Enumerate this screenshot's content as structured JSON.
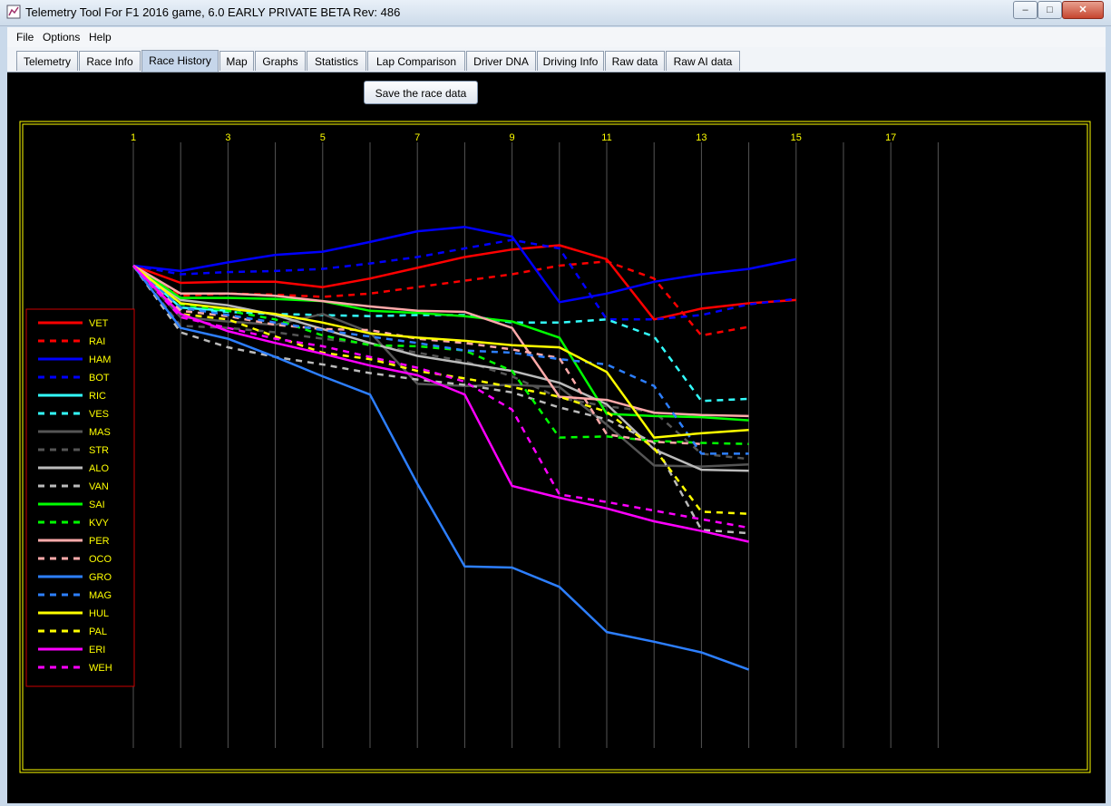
{
  "window": {
    "title": "Telemetry Tool For F1 2016 game, 6.0 EARLY PRIVATE BETA Rev: 486",
    "minimize_glyph": "–",
    "maximize_glyph": "□",
    "close_glyph": "✕"
  },
  "menu": {
    "items": [
      "File",
      "Options",
      "Help"
    ]
  },
  "tabs": [
    "Telemetry",
    "Race Info",
    "Race History",
    "Map",
    "Graphs",
    "Statistics",
    "Lap Comparison",
    "Driver DNA",
    "Driving Info",
    "Raw data",
    "Raw AI data"
  ],
  "active_tab": "Race History",
  "toolbar": {
    "save_label": "Save the race data"
  },
  "colors": {
    "background": "#000000",
    "frame": "#ffff00",
    "tick_text": "#ffff00",
    "grid": "#555555",
    "legend_border": "#cc0000",
    "legend_text": "#ffff00"
  },
  "chart_data": {
    "type": "line",
    "x_ticks": [
      "1",
      "3",
      "5",
      "7",
      "9",
      "11",
      "13",
      "15",
      "17"
    ],
    "x_range": [
      1,
      18
    ],
    "y_range": [
      -8,
      30
    ],
    "series": [
      {
        "name": "VET",
        "color": "#ff0000",
        "dash": false,
        "x": [
          1,
          2,
          3,
          4,
          5,
          6,
          7,
          8,
          9,
          10,
          11,
          12,
          13,
          14,
          15
        ],
        "values": [
          0,
          1.6,
          1.5,
          1.5,
          2.0,
          1.2,
          0.2,
          -0.8,
          -1.5,
          -1.9,
          -0.6,
          5.0,
          4.0,
          3.5,
          3.2
        ]
      },
      {
        "name": "RAI",
        "color": "#ff0000",
        "dash": true,
        "x": [
          1,
          2,
          3,
          4,
          5,
          6,
          7,
          8,
          9,
          10,
          11,
          12,
          13,
          14
        ],
        "values": [
          0,
          2.8,
          2.6,
          2.7,
          2.9,
          2.6,
          2.0,
          1.4,
          0.8,
          0.0,
          -0.4,
          1.2,
          6.5,
          5.7
        ]
      },
      {
        "name": "HAM",
        "color": "#0000ff",
        "dash": false,
        "x": [
          1,
          2,
          3,
          4,
          5,
          6,
          7,
          8,
          9,
          10,
          11,
          12,
          13,
          14,
          15
        ],
        "values": [
          0,
          0.5,
          -0.3,
          -1.0,
          -1.3,
          -2.2,
          -3.2,
          -3.6,
          -2.7,
          3.4,
          2.6,
          1.5,
          0.8,
          0.3,
          -0.6
        ]
      },
      {
        "name": "BOT",
        "color": "#0000ff",
        "dash": true,
        "x": [
          1,
          2,
          3,
          4,
          5,
          6,
          7,
          8,
          9,
          10,
          11,
          12,
          13,
          14,
          15
        ],
        "values": [
          0,
          0.8,
          0.6,
          0.5,
          0.3,
          -0.2,
          -0.8,
          -1.6,
          -2.4,
          -1.6,
          5.0,
          5.0,
          4.6,
          3.6,
          3.1
        ]
      },
      {
        "name": "RIC",
        "color": "#33ffff",
        "dash": false,
        "x": [
          1,
          2,
          3
        ],
        "values": [
          0,
          3.9,
          4.2
        ]
      },
      {
        "name": "VES",
        "color": "#33ffff",
        "dash": true,
        "x": [
          1,
          2,
          3,
          4,
          5,
          6,
          7,
          8,
          9,
          10,
          11,
          12,
          13,
          14
        ],
        "values": [
          0,
          4.0,
          4.3,
          4.5,
          4.6,
          4.7,
          4.6,
          4.6,
          5.3,
          5.3,
          5.0,
          6.6,
          12.6,
          12.4
        ]
      },
      {
        "name": "MAS",
        "color": "#555555",
        "dash": false,
        "x": [
          1,
          2,
          3,
          4,
          5,
          6,
          7,
          8,
          9,
          10,
          11,
          12,
          13,
          14
        ],
        "values": [
          0,
          4.8,
          5.2,
          5.5,
          4.5,
          6.2,
          11.0,
          11.2,
          11.1,
          11.3,
          14.8,
          18.6,
          18.7,
          18.5
        ]
      },
      {
        "name": "STR",
        "color": "#555555",
        "dash": true,
        "x": [
          1,
          2,
          3,
          4,
          5,
          6,
          7,
          8,
          9,
          10,
          11,
          12,
          13,
          14
        ],
        "values": [
          0,
          5.6,
          5.8,
          6.2,
          6.8,
          7.3,
          8.1,
          8.9,
          10.3,
          12.3,
          13.1,
          13.6,
          17.5,
          18.0
        ]
      },
      {
        "name": "ALO",
        "color": "#bbbbbb",
        "dash": false,
        "x": [
          1,
          2,
          3,
          4,
          5,
          6,
          7,
          8,
          9,
          10,
          11,
          12,
          13,
          14
        ],
        "values": [
          0,
          3.2,
          3.7,
          4.6,
          5.9,
          7.2,
          8.4,
          9.1,
          9.8,
          10.9,
          12.9,
          17.1,
          19.0,
          19.1
        ]
      },
      {
        "name": "VAN",
        "color": "#bbbbbb",
        "dash": true,
        "x": [
          1,
          2,
          3,
          4,
          5,
          6,
          7,
          8,
          9,
          10,
          11,
          12,
          13,
          14
        ],
        "values": [
          0,
          6.2,
          7.6,
          8.5,
          9.2,
          10.0,
          10.6,
          11.1,
          11.8,
          13.2,
          14.3,
          16.5,
          24.6,
          24.9
        ]
      },
      {
        "name": "SAI",
        "color": "#00ff00",
        "dash": false,
        "x": [
          1,
          2,
          3,
          4,
          5,
          6,
          7,
          8,
          9,
          10,
          11,
          12,
          13,
          14
        ],
        "values": [
          0,
          3.0,
          3.0,
          3.1,
          3.3,
          4.2,
          4.4,
          4.7,
          5.2,
          6.7,
          13.8,
          14.0,
          14.1,
          14.4
        ]
      },
      {
        "name": "KVY",
        "color": "#00ff00",
        "dash": true,
        "x": [
          1,
          2,
          3,
          4,
          5,
          6,
          7,
          8,
          9,
          10,
          11,
          12,
          13,
          14
        ],
        "values": [
          0,
          3.6,
          4.2,
          5.0,
          6.5,
          7.4,
          7.5,
          7.9,
          9.8,
          16.0,
          15.9,
          16.3,
          16.5,
          16.6
        ]
      },
      {
        "name": "PER",
        "color": "#ffaaaa",
        "dash": false,
        "x": [
          1,
          2,
          3,
          4,
          5,
          6,
          7,
          8,
          9,
          10,
          11,
          12,
          13,
          14
        ],
        "values": [
          0,
          2.6,
          2.6,
          2.8,
          3.3,
          3.8,
          4.2,
          4.3,
          5.8,
          12.2,
          12.5,
          13.7,
          13.9,
          14.0
        ]
      },
      {
        "name": "OCO",
        "color": "#ffaaaa",
        "dash": true,
        "x": [
          1,
          2,
          3,
          4,
          5,
          6,
          7,
          8,
          9,
          10,
          11,
          12,
          13
        ],
        "values": [
          0,
          4.2,
          4.7,
          5.5,
          5.9,
          6.0,
          6.8,
          7.2,
          7.8,
          8.6,
          15.7,
          16.4,
          16.6
        ]
      },
      {
        "name": "GRO",
        "color": "#2d7fff",
        "dash": false,
        "x": [
          1,
          2,
          3,
          4,
          5,
          6,
          7,
          8,
          9,
          10,
          11,
          12,
          13,
          14
        ],
        "values": [
          0,
          5.8,
          6.8,
          8.5,
          10.3,
          12.0,
          20.3,
          28.0,
          28.1,
          29.9,
          34.1,
          35.0,
          36.0,
          37.6
        ]
      },
      {
        "name": "MAG",
        "color": "#2d7fff",
        "dash": true,
        "x": [
          1,
          2,
          3,
          4,
          5,
          6,
          7,
          8,
          9,
          10,
          11,
          12,
          13,
          14
        ],
        "values": [
          0,
          3.9,
          4.6,
          5.3,
          6.0,
          6.6,
          7.2,
          7.9,
          8.1,
          8.7,
          9.2,
          11.2,
          17.5,
          17.5
        ]
      },
      {
        "name": "HUL",
        "color": "#ffff00",
        "dash": false,
        "x": [
          1,
          2,
          3,
          4,
          5,
          6,
          7,
          8,
          9,
          10,
          11,
          12,
          13,
          14
        ],
        "values": [
          0,
          3.5,
          4.0,
          4.5,
          5.3,
          6.3,
          6.7,
          7.0,
          7.4,
          7.6,
          9.9,
          16.0,
          15.6,
          15.3
        ]
      },
      {
        "name": "PAL",
        "color": "#ffff00",
        "dash": true,
        "x": [
          1,
          2,
          3,
          4,
          5,
          6,
          7,
          8,
          9,
          10,
          11,
          12,
          13,
          14
        ],
        "values": [
          0,
          4.5,
          5.0,
          6.6,
          8.1,
          8.7,
          9.8,
          10.5,
          11.3,
          12.2,
          13.6,
          17.0,
          22.9,
          23.1
        ]
      },
      {
        "name": "ERI",
        "color": "#ff00ff",
        "dash": false,
        "x": [
          1,
          2,
          3,
          4,
          5,
          6,
          7,
          8,
          9,
          10,
          11,
          12,
          13,
          14
        ],
        "values": [
          0,
          4.5,
          6.1,
          7.2,
          8.2,
          9.3,
          10.2,
          12.0,
          20.5,
          21.6,
          22.6,
          23.8,
          24.7,
          25.7
        ]
      },
      {
        "name": "WEH",
        "color": "#ff00ff",
        "dash": true,
        "x": [
          1,
          2,
          3,
          4,
          5,
          6,
          7,
          8,
          9,
          10,
          11,
          12,
          13,
          14
        ],
        "values": [
          0,
          4.8,
          5.8,
          6.8,
          7.5,
          8.5,
          9.5,
          10.8,
          13.4,
          21.3,
          22.0,
          22.8,
          23.6,
          24.4
        ]
      }
    ]
  }
}
